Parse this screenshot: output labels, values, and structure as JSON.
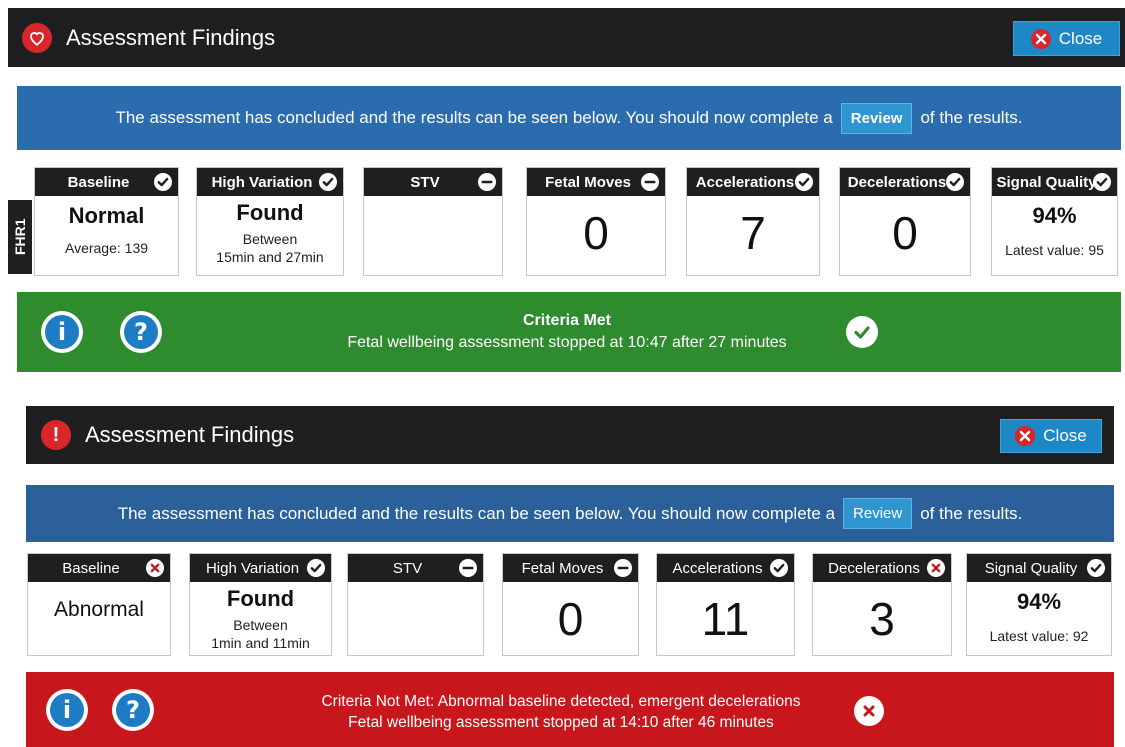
{
  "panels": [
    {
      "header": {
        "title": "Assessment Findings",
        "close_label": "Close"
      },
      "banner": {
        "before": "The assessment has concluded and the results can be seen below. You should now complete a",
        "review_label": "Review",
        "after": "of the results."
      },
      "fhr_label": "FHR1",
      "cards": [
        {
          "label": "Baseline",
          "status": "ok",
          "main": "Normal",
          "sub1": "Average: 139",
          "sub2": ""
        },
        {
          "label": "High Variation",
          "status": "ok",
          "main": "Found",
          "sub1": "Between",
          "sub2": "15min and 27min"
        },
        {
          "label": "STV",
          "status": "neutral",
          "main": "",
          "sub1": "",
          "sub2": ""
        },
        {
          "label": "Fetal Moves",
          "status": "neutral",
          "main": "0",
          "sub1": "",
          "sub2": ""
        },
        {
          "label": "Accelerations",
          "status": "ok",
          "main": "7",
          "sub1": "",
          "sub2": ""
        },
        {
          "label": "Decelerations",
          "status": "ok",
          "main": "0",
          "sub1": "",
          "sub2": ""
        },
        {
          "label": "Signal Quality",
          "status": "ok",
          "main": "94%",
          "sub1": "Latest value: 95",
          "sub2": ""
        }
      ],
      "result": {
        "line1": "Criteria Met",
        "line2": "Fetal wellbeing assessment stopped at 10:47 after 27 minutes",
        "status": "met",
        "color": "#2e8b2e"
      }
    },
    {
      "header": {
        "title": "Assessment Findings",
        "close_label": "Close"
      },
      "banner": {
        "before": "The assessment has concluded and the results can be seen below. You should now complete a",
        "review_label": "Review",
        "after": "of the results."
      },
      "cards": [
        {
          "label": "Baseline",
          "status": "fail",
          "main": "Abnormal",
          "sub1": "",
          "sub2": ""
        },
        {
          "label": "High Variation",
          "status": "ok",
          "main": "Found",
          "sub1": "Between",
          "sub2": "1min and 11min"
        },
        {
          "label": "STV",
          "status": "neutral",
          "main": "",
          "sub1": "",
          "sub2": ""
        },
        {
          "label": "Fetal Moves",
          "status": "neutral",
          "main": "0",
          "sub1": "",
          "sub2": ""
        },
        {
          "label": "Accelerations",
          "status": "ok",
          "main": "11",
          "sub1": "",
          "sub2": ""
        },
        {
          "label": "Decelerations",
          "status": "fail",
          "main": "3",
          "sub1": "",
          "sub2": ""
        },
        {
          "label": "Signal Quality",
          "status": "ok",
          "main": "94%",
          "sub1": "Latest value: 92",
          "sub2": ""
        }
      ],
      "result": {
        "line1": "Criteria Not Met: Abnormal  baseline detected, emergent decelerations",
        "line2": "Fetal wellbeing assessment stopped at 14:10 after 46 minutes",
        "status": "not-met",
        "color": "#c8161d"
      }
    }
  ],
  "colors": {
    "header": "#1f1f21",
    "banner": "#2b6cae",
    "accent": "#1d88c5",
    "ok": "#2e8b2e",
    "fail": "#c8161d"
  }
}
